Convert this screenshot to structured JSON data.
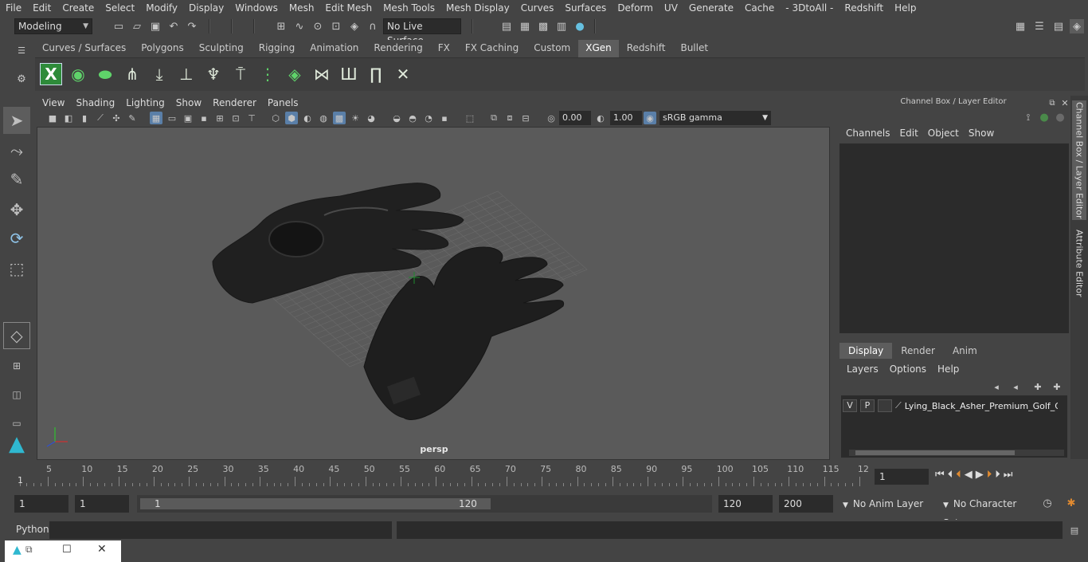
{
  "menubar": [
    "File",
    "Edit",
    "Create",
    "Select",
    "Modify",
    "Display",
    "Windows",
    "Mesh",
    "Edit Mesh",
    "Mesh Tools",
    "Mesh Display",
    "Curves",
    "Surfaces",
    "Deform",
    "UV",
    "Generate",
    "Cache",
    "- 3DtoAll -",
    "Redshift",
    "Help"
  ],
  "status": {
    "mode": "Modeling",
    "live_surface": "No Live Surface"
  },
  "shelf": {
    "tabs": [
      "Curves / Surfaces",
      "Polygons",
      "Sculpting",
      "Rigging",
      "Animation",
      "Rendering",
      "FX",
      "FX Caching",
      "Custom",
      "XGen",
      "Redshift",
      "Bullet"
    ],
    "active_tab": "XGen"
  },
  "viewport": {
    "menu": [
      "View",
      "Shading",
      "Lighting",
      "Show",
      "Renderer",
      "Panels"
    ],
    "exposure": "0.00",
    "gamma": "1.00",
    "colorspace": "sRGB gamma",
    "camera_label": "persp"
  },
  "channelbox": {
    "title": "Channel Box / Layer Editor",
    "menu": [
      "Channels",
      "Edit",
      "Object",
      "Show"
    ]
  },
  "layers": {
    "tabs": [
      "Display",
      "Render",
      "Anim"
    ],
    "active_tab": "Display",
    "menu": [
      "Layers",
      "Options",
      "Help"
    ],
    "row": {
      "v": "V",
      "p": "P",
      "name": "Lying_Black_Asher_Premium_Golf_Glove"
    }
  },
  "sidetabs": [
    "Channel Box / Layer Editor",
    "Attribute Editor"
  ],
  "timeline": {
    "ticks": [
      "5",
      "10",
      "15",
      "20",
      "25",
      "30",
      "35",
      "40",
      "45",
      "50",
      "55",
      "60",
      "65",
      "70",
      "75",
      "80",
      "85",
      "90",
      "95",
      "100",
      "105",
      "110",
      "115",
      "12"
    ],
    "start_label": "1",
    "current_frame": "1"
  },
  "range": {
    "start": "1",
    "start2": "1",
    "slider_start": "1",
    "slider_end": "120",
    "end": "120",
    "end2": "200",
    "anim_layer": "No Anim Layer",
    "character_set": "No Character Set"
  },
  "cmdline": {
    "label": "Python"
  },
  "colors": {
    "bg": "#444444",
    "viewport": "#5a5a5a",
    "accent": "#5a7fa8",
    "shelf_icon": "#2e8b3a"
  }
}
